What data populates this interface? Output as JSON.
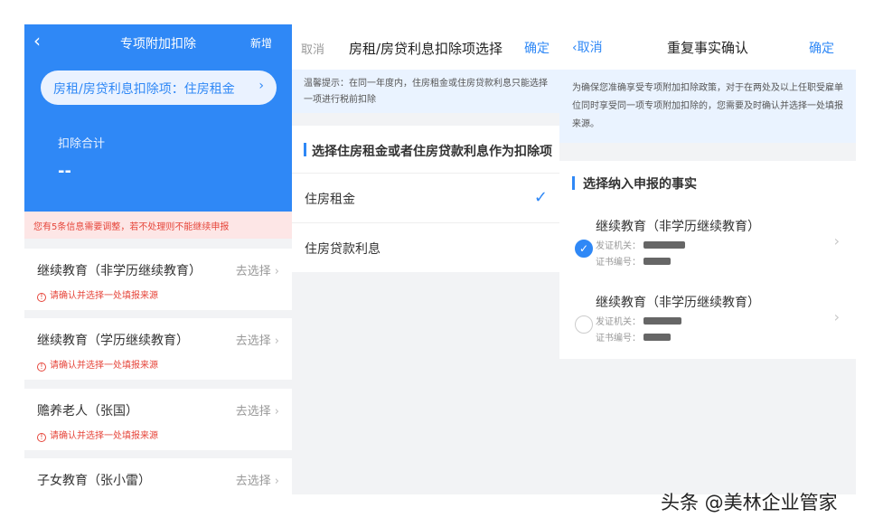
{
  "panel1": {
    "title": "专项附加扣除",
    "back_glyph": "‹",
    "new_label": "新增",
    "selector_label": "房租/房贷利息扣除项：住房租金",
    "selector_chevron": "›",
    "sum_label": "扣除合计",
    "sum_value": "--",
    "warning": "您有5条信息需要调整，若不处理则不能继续申报",
    "items": [
      {
        "title": "继续教育（非学历继续教育）",
        "action": "去选择",
        "note": "请确认并选择一处填报来源"
      },
      {
        "title": "继续教育（学历继续教育）",
        "action": "去选择",
        "note": "请确认并选择一处填报来源"
      },
      {
        "title": "赡养老人（张国）",
        "action": "去选择",
        "note": "请确认并选择一处填报来源"
      },
      {
        "title": "子女教育（张小雷）",
        "action": "去选择",
        "note": ""
      }
    ]
  },
  "panel2": {
    "cancel_label": "取消",
    "title": "房租/房贷利息扣除项选择",
    "confirm_label": "确定",
    "tip": "温馨提示：在同一年度内，住房租金或住房贷款利息只能选择一项进行税前扣除",
    "section_title": "选择住房租金或者住房贷款利息作为扣除项",
    "options": [
      {
        "label": "住房租金",
        "selected": true
      },
      {
        "label": "住房贷款利息",
        "selected": false
      }
    ],
    "check_glyph": "✓"
  },
  "panel3": {
    "cancel_label": "取消",
    "back_glyph": "‹",
    "title": "重复事实确认",
    "confirm_label": "确定",
    "tip": "为确保您准确享受专项附加扣除政策，对于在两处及以上任职受雇单位同时享受同一项专项附加扣除的，您需要及时确认并选择一处填报来源。",
    "section_title": "选择纳入申报的事实",
    "records": [
      {
        "title": "继续教育（非学历继续教育）",
        "issuer_label": "发证机关：",
        "cert_label": "证书编号：",
        "selected": true
      },
      {
        "title": "继续教育（非学历继续教育）",
        "issuer_label": "发证机关：",
        "cert_label": "证书编号：",
        "selected": false
      }
    ],
    "chevron_glyph": "›",
    "radio_check_glyph": "✓"
  },
  "watermark": "头条 @美林企业管家",
  "colors": {
    "accent": "#2f88f6",
    "warning": "#e6453a",
    "tip_bg": "#eaf3ff",
    "page_bg": "#f2f3f5"
  },
  "icons": [
    "back-chevron-icon",
    "chevron-right-icon",
    "warning-circle-icon",
    "checkmark-icon",
    "radio-checked-icon",
    "radio-empty-icon"
  ]
}
